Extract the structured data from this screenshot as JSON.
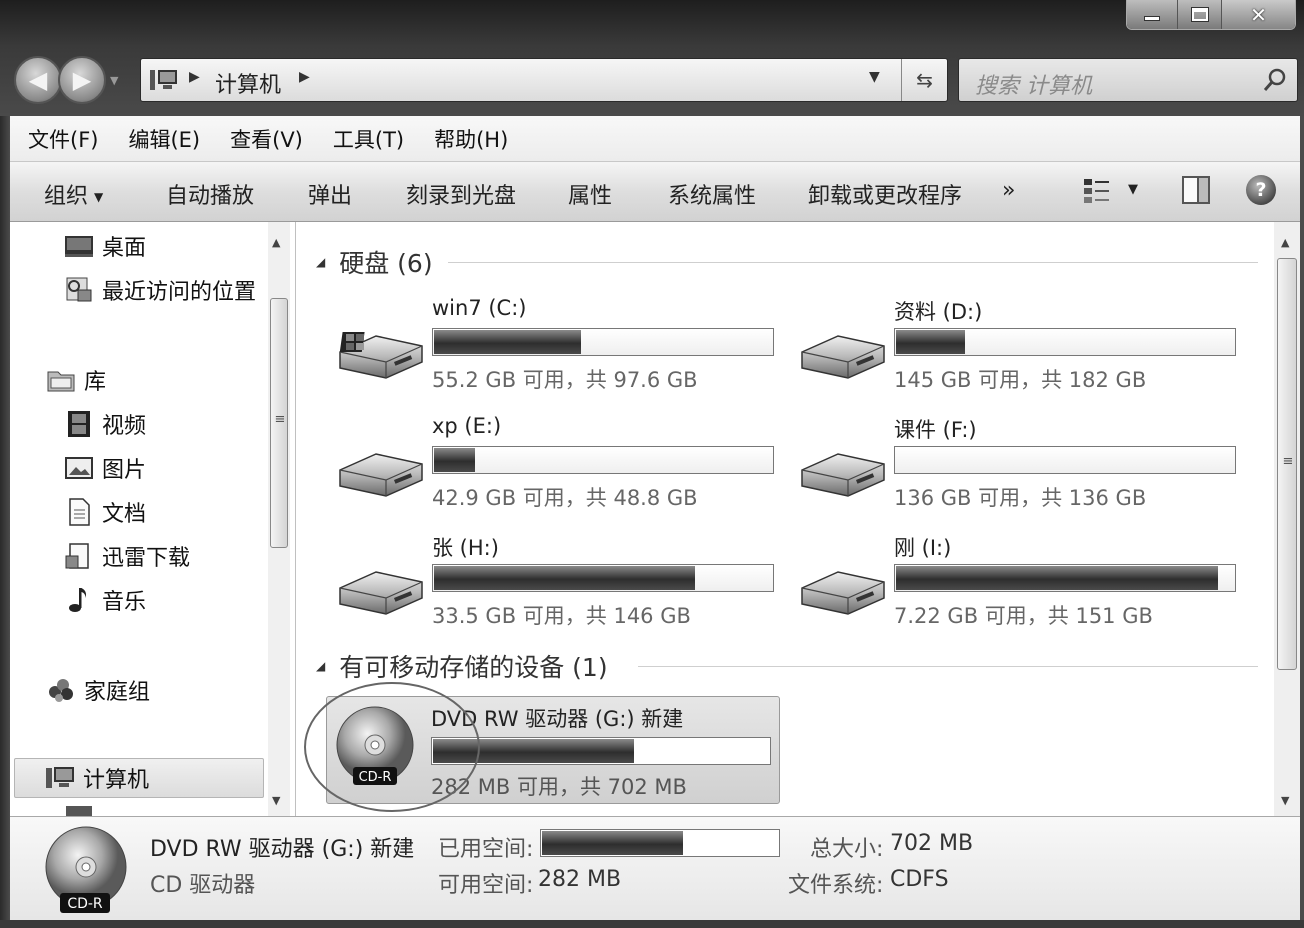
{
  "window": {
    "minimize_icon": "minimize-icon",
    "maximize_icon": "maximize-icon",
    "close_icon": "close-icon"
  },
  "address": {
    "location": "计算机",
    "search_placeholder": "搜索 计算机"
  },
  "menu": [
    "文件(F)",
    "编辑(E)",
    "查看(V)",
    "工具(T)",
    "帮助(H)"
  ],
  "commands": {
    "organize": "组织",
    "autoplay": "自动播放",
    "eject": "弹出",
    "burn": "刻录到光盘",
    "properties": "属性",
    "system_properties": "系统属性",
    "uninstall": "卸载或更改程序",
    "more": "»"
  },
  "nav": {
    "desktop": "桌面",
    "recent": "最近访问的位置",
    "library": "库",
    "videos": "视频",
    "pictures": "图片",
    "documents": "文档",
    "xunlei": "迅雷下载",
    "music": "音乐",
    "homegroup": "家庭组",
    "computer": "计算机"
  },
  "groups": {
    "hard_disks": "硬盘 (6)",
    "removable": "有可移动存储的设备 (1)"
  },
  "drives": [
    {
      "name": "win7 (C:)",
      "info": "55.2 GB 可用，共 97.6 GB",
      "used_fraction": 0.435
    },
    {
      "name": "资料 (D:)",
      "info": "145 GB 可用，共 182 GB",
      "used_fraction": 0.203
    },
    {
      "name": "xp (E:)",
      "info": "42.9 GB 可用，共 48.8 GB",
      "used_fraction": 0.121
    },
    {
      "name": "课件 (F:)",
      "info": "136 GB 可用，共 136 GB",
      "used_fraction": 0.0
    },
    {
      "name": "张 (H:)",
      "info": "33.5 GB 可用，共 146 GB",
      "used_fraction": 0.771
    },
    {
      "name": "刚 (I:)",
      "info": "7.22 GB 可用，共 151 GB",
      "used_fraction": 0.952
    }
  ],
  "dvd": {
    "name": "DVD RW 驱动器 (G:) 新建",
    "info": "282 MB 可用，共 702 MB",
    "badge": "CD-R",
    "used_fraction": 0.598
  },
  "details": {
    "name": "DVD RW 驱动器 (G:) 新建",
    "type": "CD 驱动器",
    "used_label": "已用空间:",
    "free_label": "可用空间:",
    "free_value": "282 MB",
    "total_label": "总大小:",
    "total_value": "702 MB",
    "fs_label": "文件系统:",
    "fs_value": "CDFS",
    "badge": "CD-R",
    "used_fraction": 0.598
  },
  "colors": {
    "bar_fill": "#3a3a3a",
    "selection": "#dcdcdc",
    "frame": "#3a3a3a"
  }
}
